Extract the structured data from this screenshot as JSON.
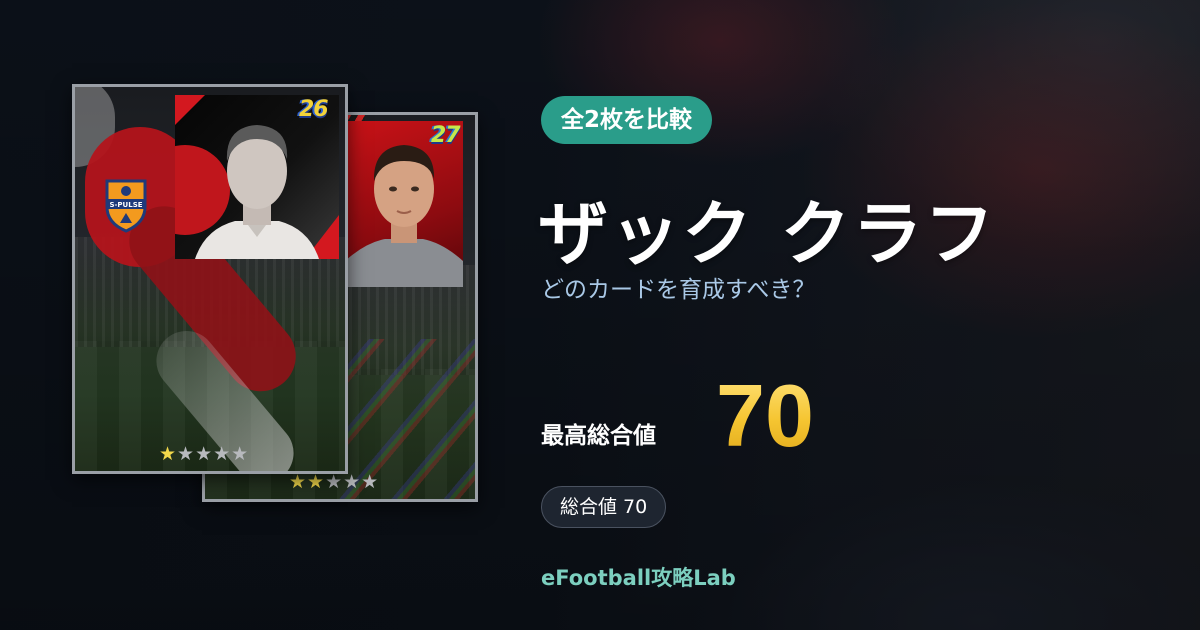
{
  "compare_badge": "全2枚を比較",
  "player_name": "ザック クラフ",
  "subtitle": "どのカードを育成すべき？",
  "max_overall": {
    "label": "最高総合値",
    "value": "70"
  },
  "overall_pill": "総合値 70",
  "site_name": "eFootball攻略Lab",
  "cards": [
    {
      "season": "26",
      "stars": {
        "on": "★",
        "off": "★★★★"
      },
      "club_badge_text": "S-PULSE"
    },
    {
      "season": "27",
      "stars": {
        "on": "★★",
        "off": "★★★"
      }
    }
  ],
  "colors": {
    "accent_teal": "#2a9d8a",
    "value_gold": "#f5c531",
    "subtitle_blue": "#a9c8e6",
    "site_teal": "#7ccfbf",
    "card_red": "#b3141b"
  }
}
